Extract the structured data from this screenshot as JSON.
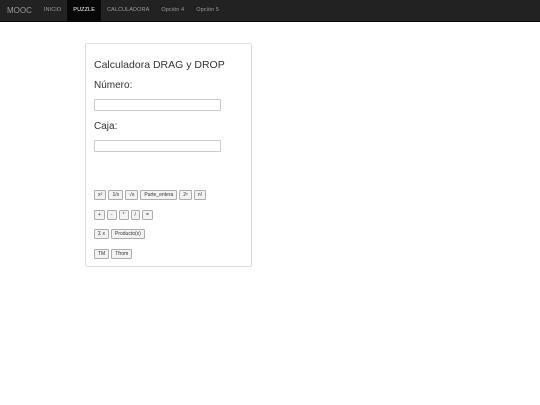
{
  "navbar": {
    "brand": "MOOC",
    "items": [
      {
        "label": "INICIO",
        "active": false
      },
      {
        "label": "PUZZLE",
        "active": true
      },
      {
        "label": "CALCULADORA",
        "active": false
      },
      {
        "label": "Opción 4",
        "active": false
      },
      {
        "label": "Opción 5",
        "active": false
      }
    ]
  },
  "panel": {
    "title": "Calculadora DRAG y DROP",
    "numero_label": "Número:",
    "numero_value": "",
    "caja_label": "Caja:",
    "caja_value": ""
  },
  "buttons": {
    "row1": {
      "square_base": "x",
      "square_exp": "2",
      "reciprocal": "1/x",
      "sqrt": "√x",
      "integer_part": "Parte_entera",
      "pow2_base": "2",
      "pow2_exp": "x",
      "factorial": "n!"
    },
    "row2": [
      "+",
      "-",
      "*",
      "/",
      "="
    ],
    "row3": [
      "Σ x",
      "Producto(x)"
    ],
    "row4": [
      "TM",
      "Tfrom"
    ]
  }
}
